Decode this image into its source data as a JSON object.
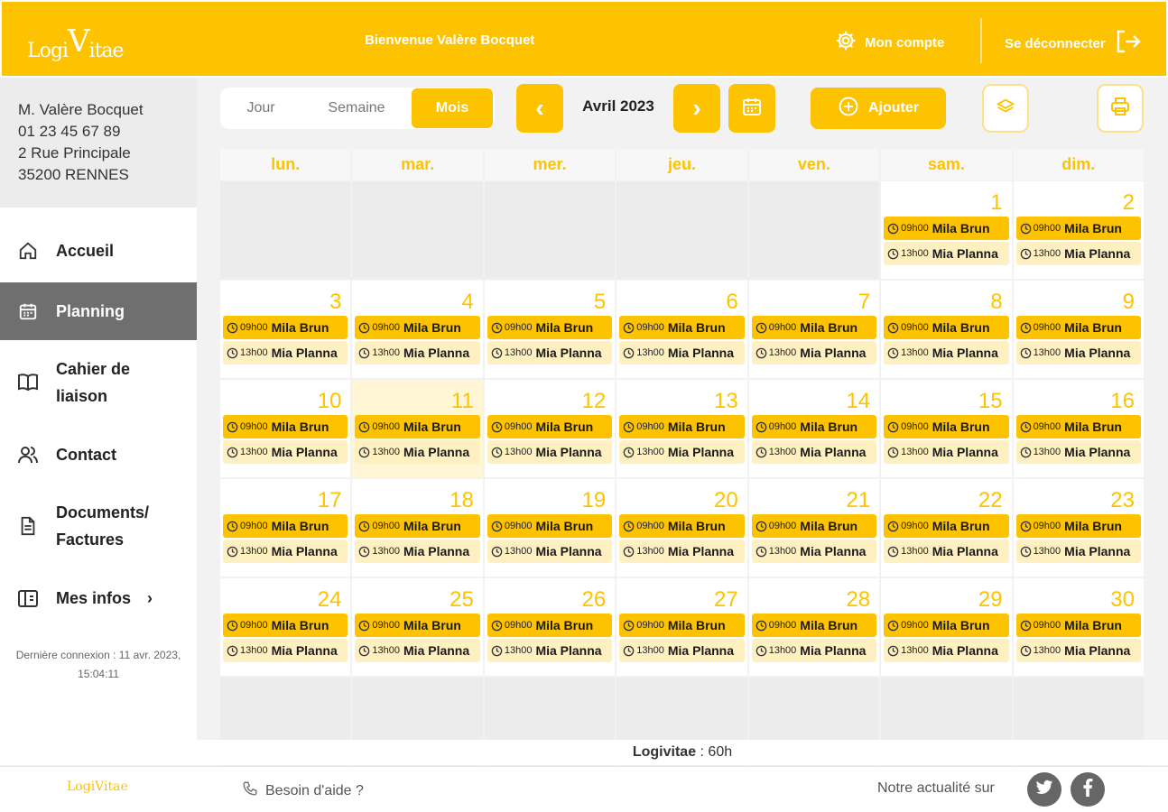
{
  "header": {
    "logo_a": "Logi",
    "logo_b": "V",
    "logo_c": "itae",
    "welcome": "Bienvenue Valère Bocquet",
    "account": "Mon compte",
    "logout": "Se déconnecter"
  },
  "user": {
    "name": "M. Valère Bocquet",
    "phone": "01 23 45 67 89",
    "street": "2 Rue Principale",
    "city": "35200 RENNES"
  },
  "nav": {
    "home": "Accueil",
    "planning": "Planning",
    "liaison_1": "Cahier de",
    "liaison_2": "liaison",
    "contact": "Contact",
    "docs_1": "Documents/",
    "docs_2": "Factures",
    "infos": "Mes infos",
    "chevron": "›"
  },
  "last_login": {
    "line1": "Dernière connexion : 11 avr. 2023,",
    "line2": "15:04:11"
  },
  "toolbar": {
    "day": "Jour",
    "week": "Semaine",
    "month": "Mois",
    "current_month": "Avril 2023",
    "add": "Ajouter",
    "prev": "‹",
    "next": "›"
  },
  "calendar": {
    "weekdays": [
      "lun.",
      "mar.",
      "mer.",
      "jeu.",
      "ven.",
      "sam.",
      "dim."
    ],
    "days": [
      "",
      "",
      "",
      "",
      "",
      "1",
      "2",
      "3",
      "4",
      "5",
      "6",
      "7",
      "8",
      "9",
      "10",
      "11",
      "12",
      "13",
      "14",
      "15",
      "16",
      "17",
      "18",
      "19",
      "20",
      "21",
      "22",
      "23",
      "24",
      "25",
      "26",
      "27",
      "28",
      "29",
      "30",
      "",
      "",
      "",
      "",
      "",
      "",
      ""
    ],
    "today": "11",
    "event1": {
      "time": "09h00",
      "name": "Mila Brun"
    },
    "event2": {
      "time": "13h00",
      "name": "Mia Planna"
    }
  },
  "summary": {
    "label": "Logivitae",
    "value": " : 60h"
  },
  "footer": {
    "logo": "LogiVitae",
    "help": "Besoin d'aide ?",
    "news": "Notre actualité sur"
  },
  "colors": {
    "accent": "#fdc300",
    "active_nav": "#6f6f6f",
    "event_light": "#fff0c2"
  },
  "icons": [
    "gear-icon",
    "logout-icon",
    "home-icon",
    "calendar-icon",
    "book-icon",
    "contacts-icon",
    "document-icon",
    "info-icon",
    "plus-circle-icon",
    "layers-icon",
    "print-icon",
    "phone-icon",
    "twitter-icon",
    "facebook-icon",
    "clock-icon"
  ]
}
